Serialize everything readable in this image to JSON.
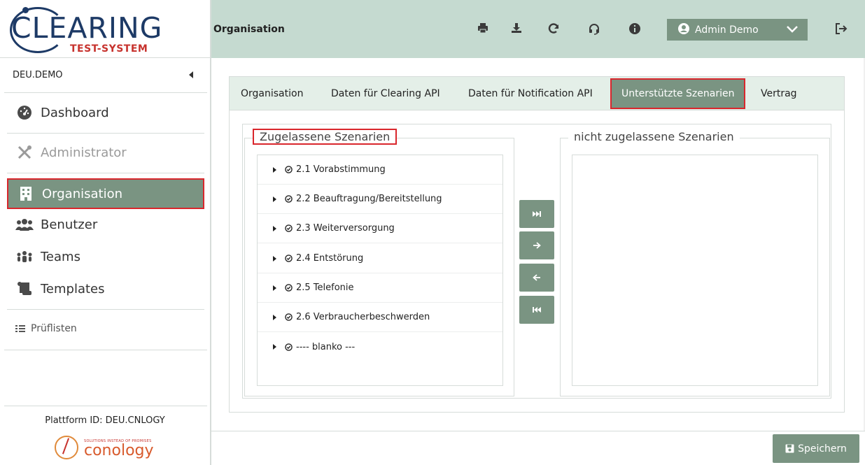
{
  "brand": {
    "logo_text": "CLEARING",
    "logo_subtitle": "TEST-SYSTEM"
  },
  "sidebar": {
    "org_code": "DEU.DEMO",
    "items": [
      {
        "label": "Dashboard",
        "icon": "gauge-icon",
        "state": "normal"
      },
      {
        "label": "Administrator",
        "icon": "tools-icon",
        "state": "disabled"
      },
      {
        "label": "Organisation",
        "icon": "building-icon",
        "state": "active"
      },
      {
        "label": "Benutzer",
        "icon": "users-icon",
        "state": "normal"
      },
      {
        "label": "Teams",
        "icon": "team-icon",
        "state": "normal"
      },
      {
        "label": "Templates",
        "icon": "scroll-icon",
        "state": "normal"
      }
    ],
    "checklists_label": "Prüflisten",
    "platform_id": "Plattform ID: DEU.CNLOGY",
    "vendor_tagline": "SOLUTIONS INSTEAD OF PROMISES",
    "vendor_name": "conology"
  },
  "header": {
    "title": "Organisation",
    "icons": [
      "print-icon",
      "download-icon",
      "refresh-icon",
      "headset-icon",
      "info-icon"
    ],
    "user_label": "Admin Demo"
  },
  "tabs": [
    {
      "label": "Organisation",
      "active": false
    },
    {
      "label": "Daten für Clearing API",
      "active": false
    },
    {
      "label": "Daten für Notification API",
      "active": false
    },
    {
      "label": "Unterstützte Szenarien",
      "active": true
    },
    {
      "label": "Vertrag",
      "active": false
    }
  ],
  "allowed": {
    "legend": "Zugelassene Szenarien",
    "items": [
      "2.1 Vorabstimmung",
      "2.2 Beauftragung/Bereitstellung",
      "2.3 Weiterversorgung",
      "2.4 Entstörung",
      "2.5 Telefonie",
      "2.6 Verbraucherbeschwerden",
      "---- blanko ---"
    ]
  },
  "not_allowed": {
    "legend": "nicht zugelassene Szenarien",
    "items": []
  },
  "move_buttons": [
    "move-all-right-icon",
    "move-right-icon",
    "move-left-icon",
    "move-all-left-icon"
  ],
  "footer": {
    "save_label": "Speichern"
  },
  "colors": {
    "accent": "#7a9482",
    "header_bg": "#c5dad0",
    "tabbar_bg": "#e4efe8",
    "highlight": "#d9262c",
    "logo_blue": "#1d3a66",
    "logo_red": "#c7332e"
  }
}
